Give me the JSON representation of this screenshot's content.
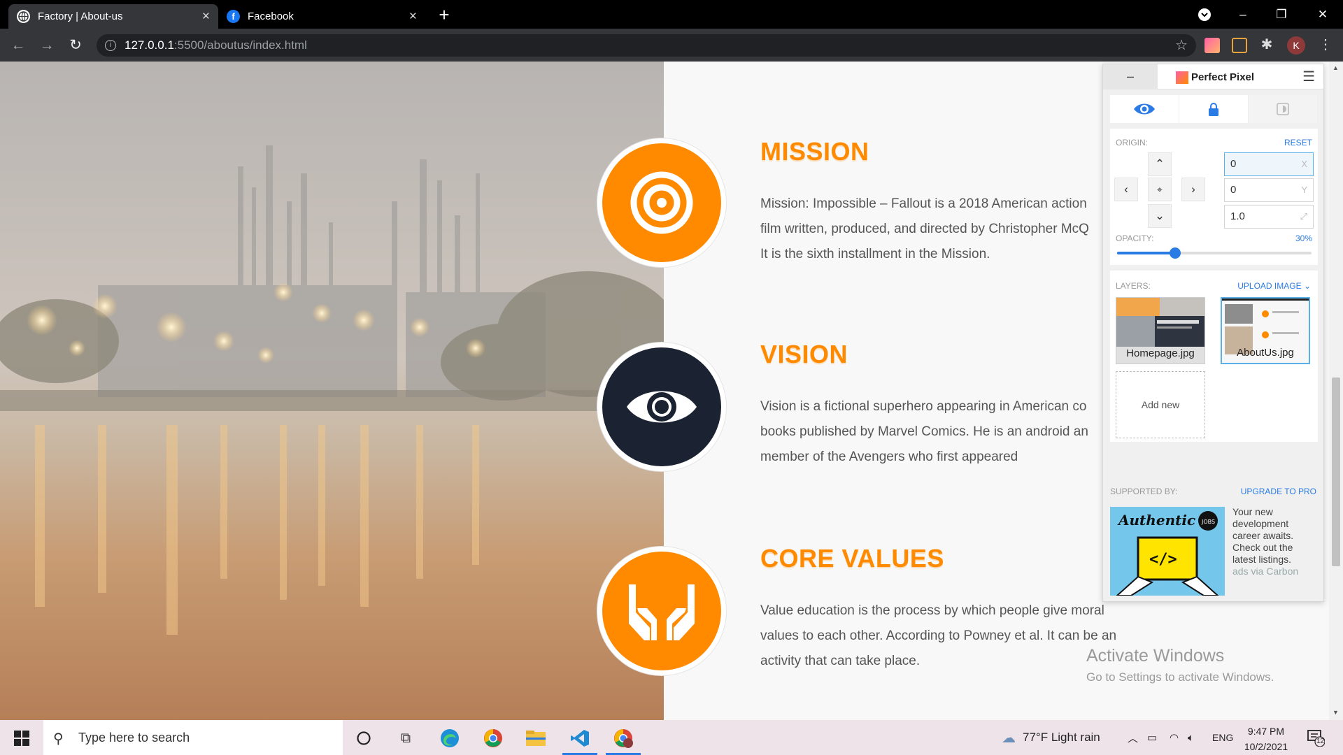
{
  "browser": {
    "tabs": [
      {
        "title": "Factory | About-us",
        "icon": "globe-icon"
      },
      {
        "title": "Facebook",
        "icon": "facebook-icon"
      }
    ],
    "url_host": "127.0.0.1",
    "url_path": ":5500/aboutus/index.html",
    "profile_initial": "K"
  },
  "sections": [
    {
      "title": "MISSION",
      "icon": "target-icon",
      "color": "#ff8a00",
      "body": "Mission: Impossible – Fallout is a 2018 American action\nfilm written, produced, and directed by Christopher McQ\nIt is the sixth installment in the Mission."
    },
    {
      "title": "VISION",
      "icon": "eye-icon",
      "color": "#1b2332",
      "body": "Vision is a fictional superhero appearing in American co\nbooks published by Marvel Comics. He is an android an\nmember of the Avengers who first appeared"
    },
    {
      "title": "CORE VALUES",
      "icon": "hands-icon",
      "color": "#ff8a00",
      "body": "Value education is the process by which people give moral\nvalues to each other. According to Powney et al. It can be an\nactivity that can take place."
    }
  ],
  "perfect_pixel": {
    "title": "Perfect Pixel",
    "minimize": "–",
    "origin_label": "ORIGIN:",
    "reset_label": "RESET",
    "x_value": "0",
    "x_suffix": "X",
    "y_value": "0",
    "y_suffix": "Y",
    "scale_value": "1.0",
    "opacity_label": "OPACITY:",
    "opacity_value": "30%",
    "opacity_fraction": 0.3,
    "layers_label": "LAYERS:",
    "upload_label": "UPLOAD IMAGE",
    "layers": [
      "Homepage.jpg",
      "AboutUs.jpg"
    ],
    "add_new_label": "Add new",
    "supported_by_label": "SUPPORTED BY:",
    "upgrade_label": "UPGRADE TO PRO",
    "ad_brand": "Authentic",
    "ad_badge": "JOBS",
    "ad_text": "Your new development career awaits. Check out the latest listings.",
    "ad_via": "ads via Carbon"
  },
  "watermark": {
    "line1": "Activate Windows",
    "line2": "Go to Settings to activate Windows."
  },
  "taskbar": {
    "search_placeholder": "Type here to search",
    "weather": "77°F  Light rain",
    "language": "ENG",
    "time": "9:47 PM",
    "date": "10/2/2021",
    "notification_count": "12"
  },
  "colors": {
    "accent": "#ff8a00",
    "navy": "#1b2332",
    "link_blue": "#2a7be4"
  }
}
